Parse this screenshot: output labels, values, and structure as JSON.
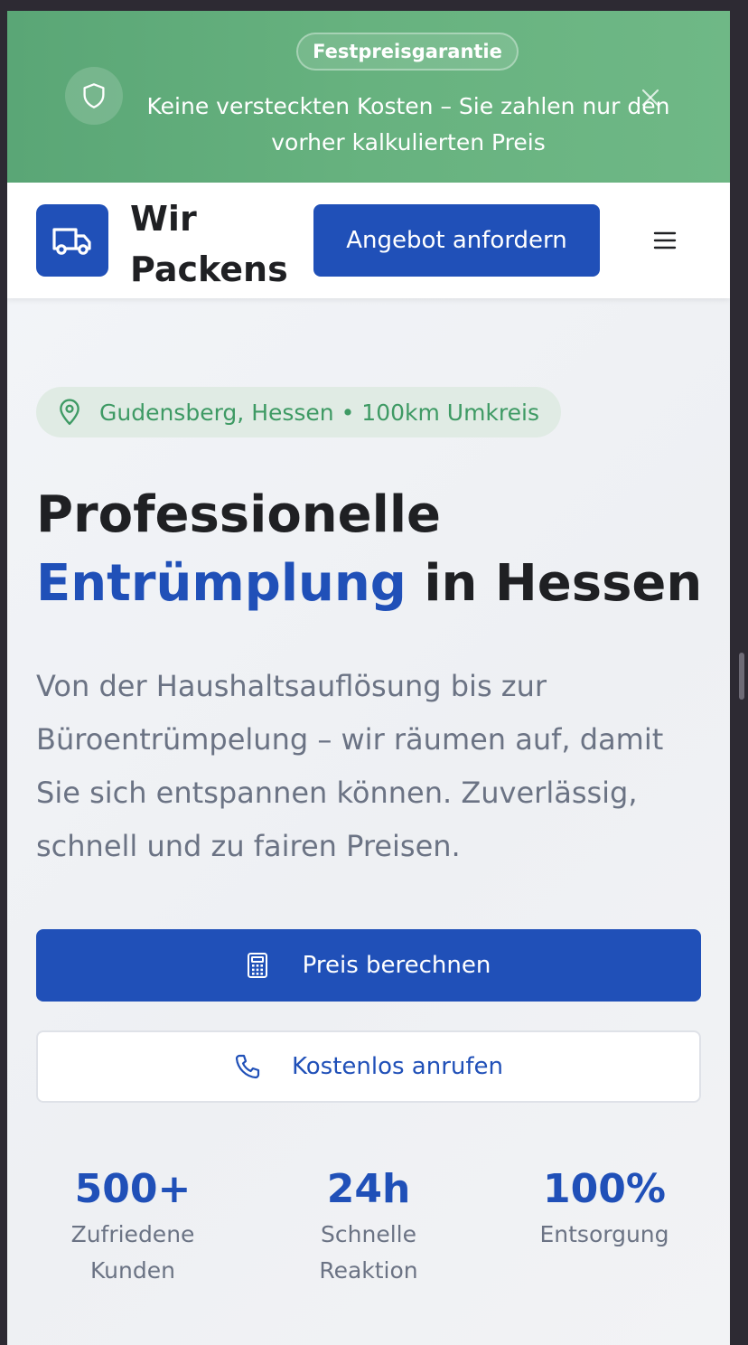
{
  "banner": {
    "badge": "Festpreisgarantie",
    "icon": "shield-icon",
    "text": "Keine versteckten Kosten – Sie zahlen nur den vorher kalkulierten Preis",
    "close_icon": "close-icon"
  },
  "header": {
    "logo_icon": "truck-icon",
    "brand_line1": "Wir",
    "brand_line2": "Packens",
    "cta_label": "Angebot anfordern",
    "menu_icon": "hamburger-menu-icon"
  },
  "hero": {
    "location_icon": "map-pin-icon",
    "location": "Gudensberg, Hessen • 100km Umkreis",
    "title_part1": "Professionelle",
    "title_accent": "Entrümplung",
    "title_part2": "in Hessen",
    "lead": "Von der Haushaltsauflösung bis zur Büroentrümpelung – wir räumen auf, damit Sie sich entspannen können. Zuverlässig, schnell und zu fairen Preisen.",
    "primary_button": "Preis berechnen",
    "primary_icon": "calculator-icon",
    "secondary_button": "Kostenlos anrufen",
    "secondary_icon": "phone-icon"
  },
  "stats": [
    {
      "value": "500+",
      "label": "Zufriedene Kunden"
    },
    {
      "value": "24h",
      "label": "Schnelle Reaktion"
    },
    {
      "value": "100%",
      "label": "Entsorgung"
    }
  ],
  "colors": {
    "primary": "#2050b8",
    "banner_green": "#67b27f",
    "location_green": "#3e9a64",
    "text_dark": "#1f2023",
    "text_muted": "#6b7384"
  }
}
